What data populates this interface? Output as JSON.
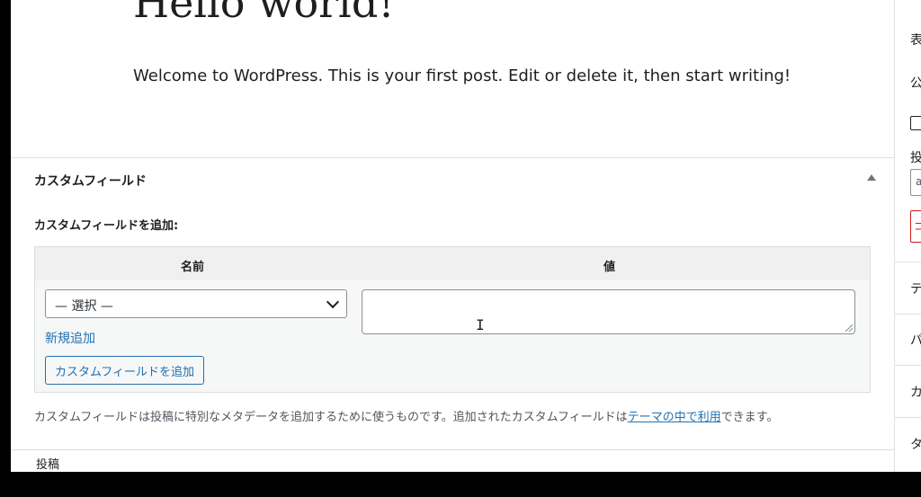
{
  "post": {
    "title": "Hello world!",
    "body": "Welcome to WordPress. This is your first post. Edit or delete it, then start writing!"
  },
  "custom_fields": {
    "panel_title": "カスタムフィールド",
    "add_label": "カスタムフィールドを追加:",
    "columns": {
      "name": "名前",
      "value": "値"
    },
    "select_value": "— 選択 —",
    "new_link": "新規追加",
    "add_button": "カスタムフィールドを追加",
    "description_prefix": "カスタムフィールドは投稿に特別なメタデータを追加するために使うものです。追加されたカスタムフィールドは",
    "description_link": "テーマの中で利用",
    "description_suffix": "できます。"
  },
  "footer": {
    "label": "投稿"
  },
  "sidebar": {
    "items": [
      "表",
      "公",
      "投",
      "テ",
      "パ",
      "カ",
      "タ"
    ],
    "input_value": "a",
    "red_button": "コ"
  },
  "colors": {
    "link": "#2271b1",
    "danger": "#cc1818"
  },
  "icons": [
    "collapse-up-icon",
    "chevron-down-icon",
    "text-cursor-icon",
    "resize-handle-icon"
  ]
}
